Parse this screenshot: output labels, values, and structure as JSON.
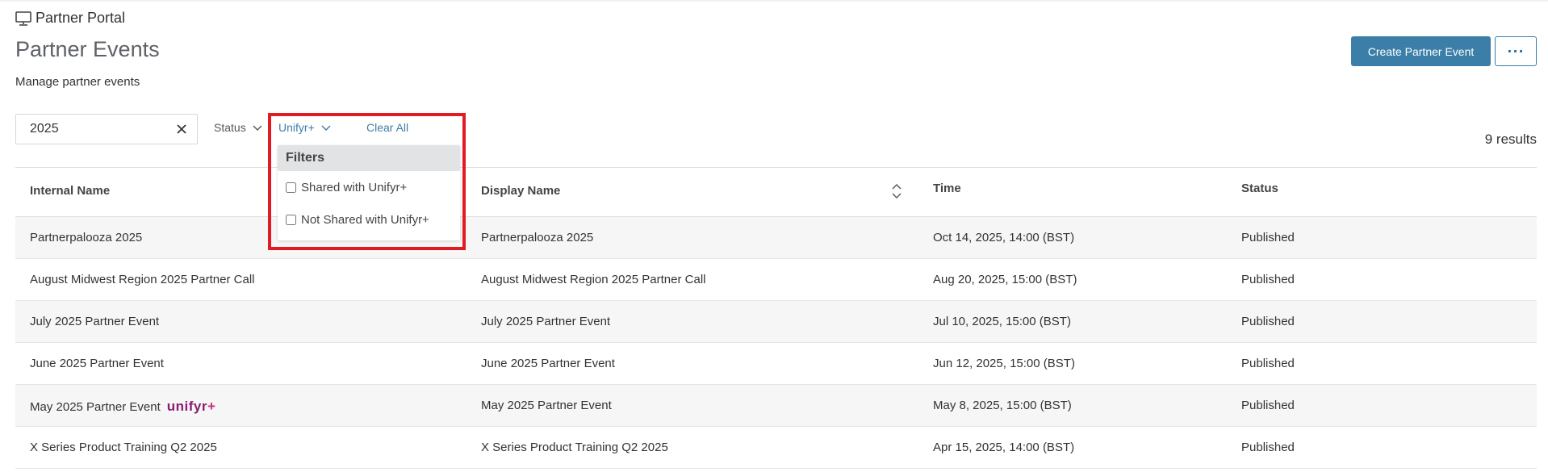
{
  "header": {
    "portal_name": "Partner Portal",
    "page_title": "Partner Events",
    "subtitle": "Manage partner events",
    "create_button": "Create Partner Event",
    "more_button": "···"
  },
  "search": {
    "value": "2025",
    "placeholder": ""
  },
  "filters": {
    "status_label": "Status",
    "unifyr_label": "Unifyr+",
    "clear_all": "Clear All",
    "dropdown": {
      "heading": "Filters",
      "options": [
        {
          "label": "Shared with Unifyr+",
          "checked": false
        },
        {
          "label": "Not Shared with Unifyr+",
          "checked": false
        }
      ]
    }
  },
  "results_text": "9 results",
  "table": {
    "columns": [
      "Internal Name",
      "Display Name",
      "Time",
      "Status"
    ],
    "rows": [
      {
        "internal": "Partnerpalooza 2025",
        "display": "Partnerpalooza 2025",
        "time": "Oct 14, 2025, 14:00 (BST)",
        "status": "Published",
        "badge": ""
      },
      {
        "internal": "August Midwest Region 2025 Partner Call",
        "display": "August Midwest Region 2025 Partner Call",
        "time": "Aug 20, 2025, 15:00 (BST)",
        "status": "Published",
        "badge": ""
      },
      {
        "internal": "July 2025 Partner Event",
        "display": "July 2025 Partner Event",
        "time": "Jul 10, 2025, 15:00 (BST)",
        "status": "Published",
        "badge": ""
      },
      {
        "internal": "June 2025 Partner Event",
        "display": "June 2025 Partner Event",
        "time": "Jun 12, 2025, 15:00 (BST)",
        "status": "Published",
        "badge": ""
      },
      {
        "internal": "May 2025 Partner Event",
        "display": "May 2025 Partner Event",
        "time": "May 8, 2025, 15:00 (BST)",
        "status": "Published",
        "badge": "unifyr"
      },
      {
        "internal": "X Series Product Training Q2 2025",
        "display": "X Series Product Training Q2 2025",
        "time": "Apr 15, 2025, 14:00 (BST)",
        "status": "Published",
        "badge": ""
      }
    ]
  },
  "brand_badge": {
    "text": "unifyr",
    "plus": "+"
  },
  "colors": {
    "accent": "#3b7ea8",
    "highlight": "#e21b23",
    "brand": "#8a1e6f"
  },
  "icons": {
    "portal": "monitor-icon",
    "clear": "close-icon",
    "sort": "sort-icon",
    "chevron": "chevron-down-icon"
  }
}
